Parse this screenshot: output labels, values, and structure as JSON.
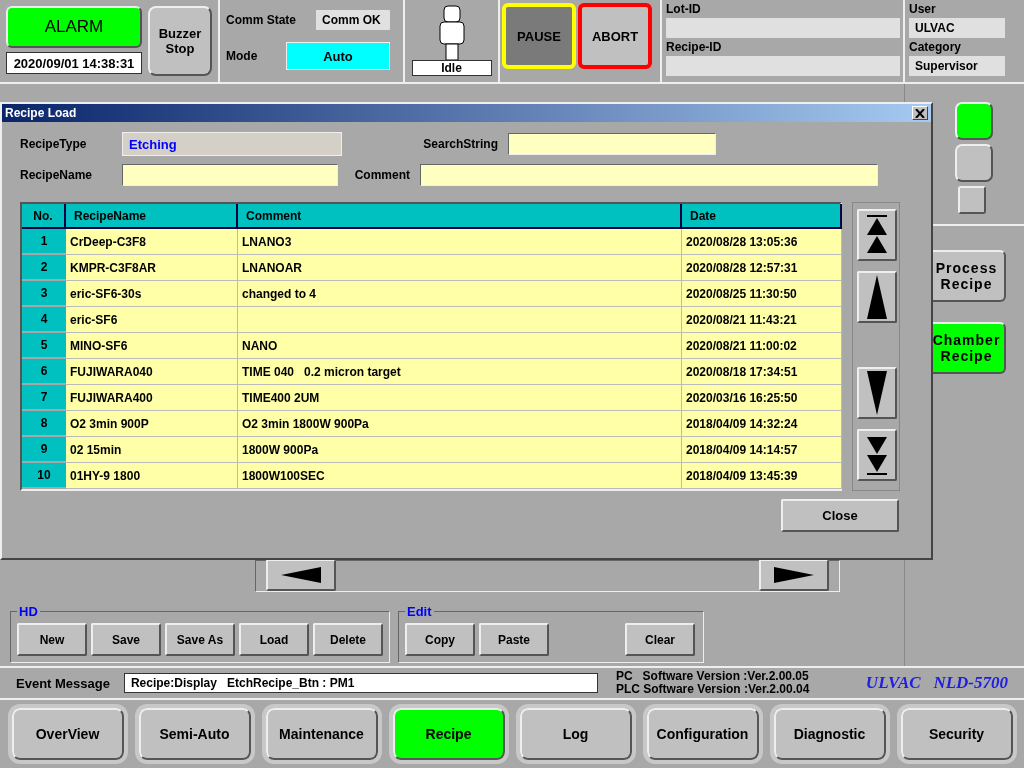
{
  "alarm": {
    "label": "ALARM",
    "active": true
  },
  "datetime": "2020/09/01 14:38:31",
  "buzzer_button": "Buzzer Stop",
  "comm_state": {
    "label": "Comm State",
    "value": "Comm OK"
  },
  "mode": {
    "label": "Mode",
    "value": "Auto"
  },
  "robot_state": "Idle",
  "run_buttons": [
    {
      "label": "PAUSE",
      "color": "#ffff00",
      "pressed": true
    },
    {
      "label": "ABORT",
      "color": "#ff0000",
      "pressed": false
    }
  ],
  "ids": [
    {
      "label": "Lot-ID"
    },
    {
      "label": "Recipe-ID"
    }
  ],
  "user": {
    "label": "User",
    "value": "ULVAC"
  },
  "category": {
    "label": "Category",
    "value": "Supervisor"
  },
  "dialog": {
    "title": "Recipe Load",
    "recipe_type": {
      "label": "RecipeType",
      "value": "Etching"
    },
    "search": {
      "label": "SearchString"
    },
    "recipe_name": {
      "label": "RecipeName"
    },
    "comment": {
      "label": "Comment"
    },
    "table": {
      "columns": [
        "No.",
        "RecipeName",
        "Comment",
        "Date"
      ],
      "rows": [
        [
          "1",
          "CrDeep-C3F8",
          "LNANO3",
          "2020/08/28 13:05:36"
        ],
        [
          "2",
          "KMPR-C3F8AR",
          "LNANOAR",
          "2020/08/28 12:57:31"
        ],
        [
          "3",
          "eric-SF6-30s",
          "changed to 4",
          "2020/08/25 11:30:50"
        ],
        [
          "4",
          "eric-SF6",
          "",
          "2020/08/21 11:43:21"
        ],
        [
          "5",
          "MINO-SF6",
          "NANO",
          "2020/08/21 11:00:02"
        ],
        [
          "6",
          "FUJIWARA040",
          "TIME 040   0.2 micron target",
          "2020/08/18 17:34:51"
        ],
        [
          "7",
          "FUJIWARA400",
          "TIME400 2UM",
          "2020/03/16 16:25:50"
        ],
        [
          "8",
          "O2 3min 900P",
          "O2 3min 1800W 900Pa",
          "2018/04/09 14:32:24"
        ],
        [
          "9",
          "02 15min",
          "1800W 900Pa",
          "2018/04/09 14:14:57"
        ],
        [
          "10",
          "01HY-9 1800",
          "1800W100SEC",
          "2018/04/09 13:45:39"
        ]
      ]
    },
    "close_button": "Close"
  },
  "hd_group": {
    "title": "HD",
    "buttons": [
      "New",
      "Save",
      "Save As",
      "Load",
      "Delete"
    ]
  },
  "edit_group": {
    "title": "Edit",
    "buttons": [
      "Copy",
      "Paste"
    ],
    "clear_button": "Clear"
  },
  "lamps": [
    {
      "on": true
    },
    {
      "on": false
    }
  ],
  "side_buttons": [
    {
      "label": "Process Recipe",
      "selected": false
    },
    {
      "label": "Chamber Recipe",
      "selected": true
    }
  ],
  "event": {
    "label": "Event Message",
    "value": "Recipe:Display   EtchRecipe_Btn : PM1"
  },
  "versions": [
    "PC   Software Version :Ver.2.00.05",
    "PLC Software Version :Ver.2.00.04"
  ],
  "brand": "ULVAC   NLD-5700",
  "nav": [
    {
      "label": "OverView",
      "selected": false
    },
    {
      "label": "Semi-Auto",
      "selected": false
    },
    {
      "label": "Maintenance",
      "selected": false
    },
    {
      "label": "Recipe",
      "selected": true
    },
    {
      "label": "Log",
      "selected": false
    },
    {
      "label": "Configuration",
      "selected": false
    },
    {
      "label": "Diagnostic",
      "selected": false
    },
    {
      "label": "Security",
      "selected": false
    }
  ]
}
